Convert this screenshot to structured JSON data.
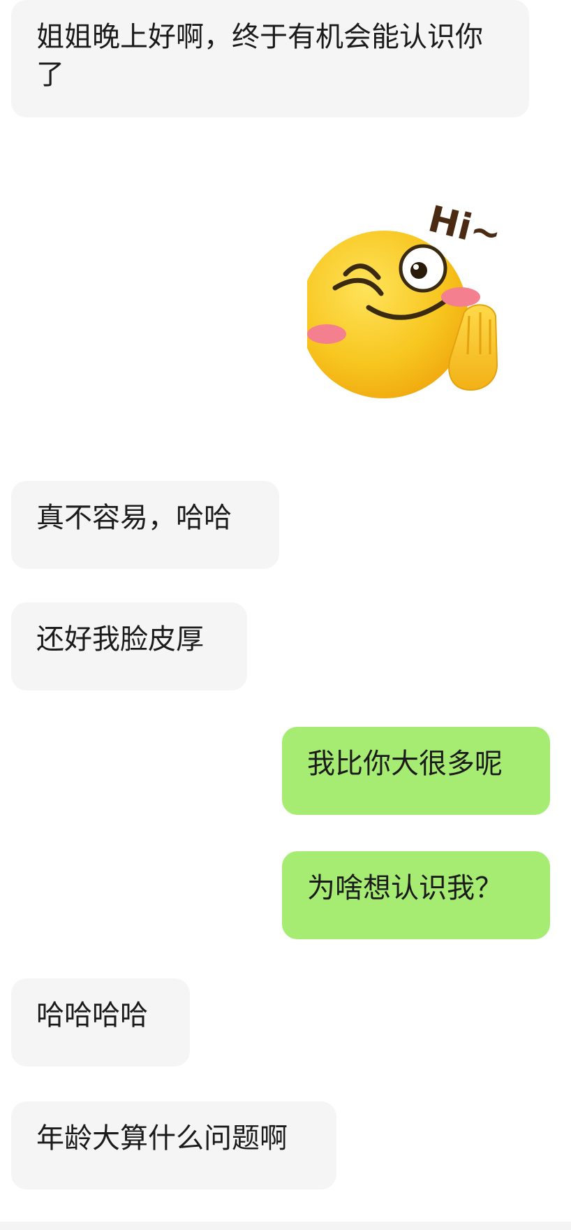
{
  "messages": [
    {
      "side": "incoming",
      "text": "姐姐晚上好啊，终于有机会能认识你了"
    },
    {
      "side": "incoming",
      "sticker": "hi-wink-emoji",
      "sticker_text": "Hi~"
    },
    {
      "side": "incoming",
      "text": "真不容易，哈哈"
    },
    {
      "side": "incoming",
      "text": "还好我脸皮厚"
    },
    {
      "side": "outgoing",
      "text": "我比你大很多呢"
    },
    {
      "side": "outgoing",
      "text": "为啥想认识我？"
    },
    {
      "side": "incoming",
      "text": "哈哈哈哈"
    },
    {
      "side": "incoming",
      "text": "年龄大算什么问题啊"
    }
  ],
  "colors": {
    "incoming_bubble": "#f5f5f5",
    "outgoing_bubble": "#a6ec72",
    "emoji_face": "#f7c51e",
    "blush": "#f47f8f"
  }
}
